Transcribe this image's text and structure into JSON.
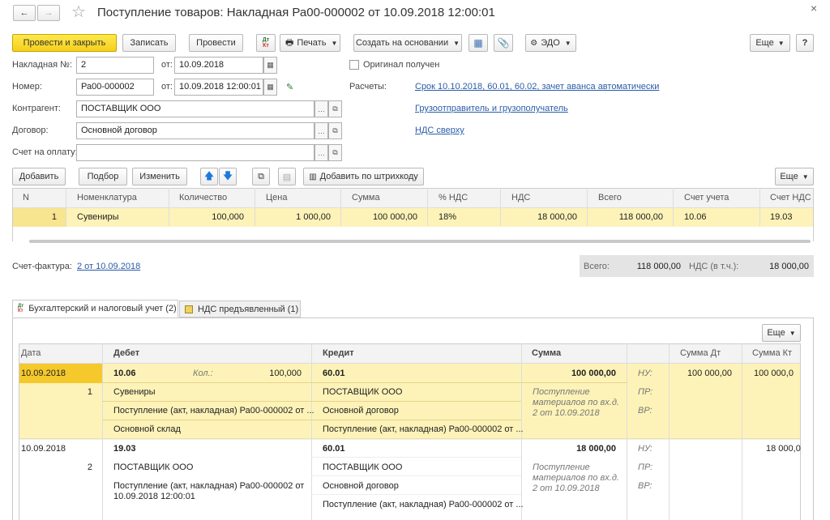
{
  "window": {
    "title": "Поступление товаров: Накладная Ра00-000002 от 10.09.2018 12:00:01",
    "close": "×"
  },
  "nav": {
    "back": "←",
    "forward": "→",
    "star": "☆"
  },
  "toolbar": {
    "post_close": "Провести и закрыть",
    "save": "Записать",
    "post": "Провести",
    "dtkt": "Дт Кт",
    "print": "Печать",
    "create_based": "Создать на основании",
    "edo": "ЭДО",
    "more": "Еще",
    "help": "?"
  },
  "form": {
    "invoice_no_label": "Накладная №:",
    "invoice_no": "2",
    "from_label": "от:",
    "invoice_date": "10.09.2018",
    "original_received": "Оригинал получен",
    "number_label": "Номер:",
    "number": "Ра00-000002",
    "number_date": "10.09.2018 12:00:01",
    "settlements_label": "Расчеты:",
    "settlements_link": "Срок 10.10.2018, 60.01, 60.02, зачет аванса автоматически",
    "contractor_label": "Контрагент:",
    "contractor": "ПОСТАВЩИК ООО",
    "shipper_link": "Грузоотправитель и грузополучатель",
    "contract_label": "Договор:",
    "contract": "Основной договор",
    "vat_link": "НДС сверху",
    "payment_invoice_label": "Счет на оплату:",
    "payment_invoice": ""
  },
  "items_toolbar": {
    "add": "Добавить",
    "pick": "Подбор",
    "change": "Изменить",
    "barcode": "Добавить по штрихкоду",
    "more": "Еще"
  },
  "items_table": {
    "headers": [
      "N",
      "Номенклатура",
      "Количество",
      "Цена",
      "Сумма",
      "% НДС",
      "НДС",
      "Всего",
      "Счет учета",
      "Счет НДС"
    ],
    "rows": [
      [
        "1",
        "Сувениры",
        "100,000",
        "1 000,00",
        "100 000,00",
        "18%",
        "18 000,00",
        "118 000,00",
        "10.06",
        "19.03"
      ]
    ]
  },
  "footer": {
    "invoice_label": "Счет-фактура:",
    "invoice_link": "2 от 10.09.2018",
    "total_label": "Всего:",
    "total": "118 000,00",
    "vat_label": "НДС (в т.ч.):",
    "vat": "18 000,00"
  },
  "tabs": [
    {
      "label": "Бухгалтерский и налоговый учет (2)",
      "icon": "dtkt-icon"
    },
    {
      "label": "НДС предъявленный (1)",
      "icon": "document-icon"
    }
  ],
  "postings": {
    "more": "Еще",
    "headers": {
      "date": "Дата",
      "debit": "Дебет",
      "credit": "Кредит",
      "sum": "Сумма",
      "sum_dt": "Сумма Дт",
      "sum_kt": "Сумма Кт"
    },
    "entries": [
      {
        "date": "10.09.2018",
        "n": "1",
        "debit_acc": "10.06",
        "qty_label": "Кол.:",
        "qty": "100,000",
        "debit_lines": [
          "Сувениры",
          "Поступление (акт, накладная) Ра00-000002 от ...",
          "Основной склад"
        ],
        "credit_acc": "60.01",
        "credit_lines": [
          "ПОСТАВЩИК ООО",
          "Основной договор",
          "Поступление (акт, накладная) Ра00-000002 от ..."
        ],
        "sum": "100 000,00",
        "note": [
          "Поступление",
          "материалов по вх.д.",
          "2 от 10.09.2018"
        ],
        "tax_labels": [
          "НУ:",
          "ПР:",
          "ВР:"
        ],
        "sum_dt": "100 000,00",
        "sum_kt": "100 000,0"
      },
      {
        "date": "10.09.2018",
        "n": "2",
        "debit_acc": "19.03",
        "debit_lines": [
          "ПОСТАВЩИК ООО",
          "Поступление (акт, накладная) Ра00-000002 от",
          "10.09.2018 12:00:01"
        ],
        "credit_acc": "60.01",
        "credit_lines": [
          "ПОСТАВЩИК ООО",
          "Основной договор",
          "Поступление (акт, накладная) Ра00-000002 от ..."
        ],
        "sum": "18 000,00",
        "note": [
          "Поступление",
          "материалов по вх.д.",
          "2 от 10.09.2018"
        ],
        "tax_labels": [
          "НУ:",
          "ПР:",
          "ВР:"
        ],
        "sum_kt": "18 000,0"
      }
    ]
  },
  "colors": {
    "accent_yellow": "#f5cf1a",
    "selected_row": "#fdf3b8",
    "link": "#2a5ca8"
  }
}
